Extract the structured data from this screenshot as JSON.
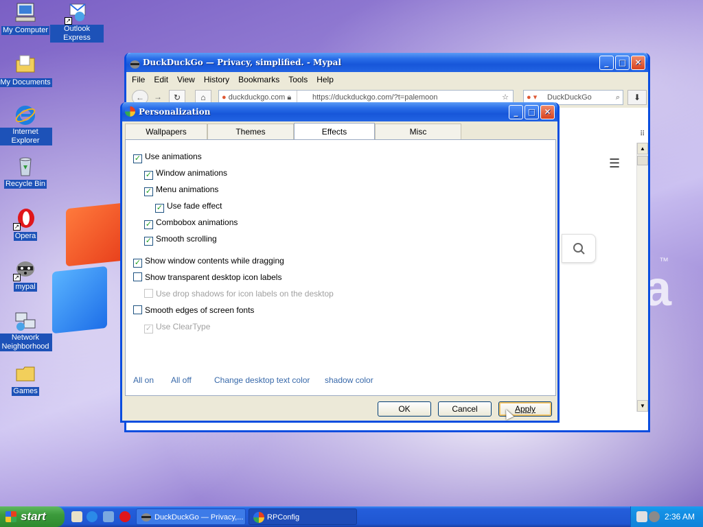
{
  "desktop": {
    "icons": [
      {
        "label": "My Computer"
      },
      {
        "label": "Outlook Express"
      },
      {
        "label": "My Documents"
      },
      {
        "label": "Internet Explorer"
      },
      {
        "label": "Recycle Bin"
      },
      {
        "label": "Opera"
      },
      {
        "label": "mypal"
      },
      {
        "label": "Network Neighborhood"
      },
      {
        "label": "Games"
      }
    ],
    "trademark": "™"
  },
  "browser": {
    "title": "DuckDuckGo — Privacy, simplified. - Mypal",
    "menu": [
      "File",
      "Edit",
      "View",
      "History",
      "Bookmarks",
      "Tools",
      "Help"
    ],
    "site_identity": "duckduckgo.com",
    "url": "https://duckduckgo.com/?t=palemoon",
    "search_placeholder": "DuckDuckGo"
  },
  "dialog": {
    "title": "Personalization",
    "tabs": [
      {
        "label": "Wallpapers",
        "active": false
      },
      {
        "label": "Themes",
        "active": false
      },
      {
        "label": "Effects",
        "active": true
      },
      {
        "label": "Misc",
        "active": false
      }
    ],
    "options": [
      {
        "label": "Use animations",
        "checked": true,
        "enabled": true
      },
      {
        "label": "Window animations",
        "checked": true,
        "enabled": true
      },
      {
        "label": "Menu animations",
        "checked": true,
        "enabled": true
      },
      {
        "label": "Use fade effect",
        "checked": true,
        "enabled": true
      },
      {
        "label": "Combobox animations",
        "checked": true,
        "enabled": true
      },
      {
        "label": "Smooth scrolling",
        "checked": true,
        "enabled": true
      },
      {
        "label": "Show window contents while dragging",
        "checked": true,
        "enabled": true
      },
      {
        "label": "Show transparent desktop icon labels",
        "checked": false,
        "enabled": true
      },
      {
        "label": "Use drop shadows for icon labels on the desktop",
        "checked": false,
        "enabled": false
      },
      {
        "label": "Smooth edges of screen fonts",
        "checked": false,
        "enabled": true
      },
      {
        "label": "Use ClearType",
        "checked": true,
        "enabled": false
      }
    ],
    "links": {
      "all_on": "All on",
      "all_off": "All off",
      "text_color": "Change desktop text color",
      "shadow_color": "shadow color"
    },
    "buttons": {
      "ok": "OK",
      "cancel": "Cancel",
      "apply": "Apply"
    }
  },
  "taskbar": {
    "start_label": "start",
    "tasks": [
      {
        "label": "DuckDuckGo — Privacy,..."
      },
      {
        "label": "RPConfig"
      }
    ],
    "clock": "2:36 AM"
  }
}
